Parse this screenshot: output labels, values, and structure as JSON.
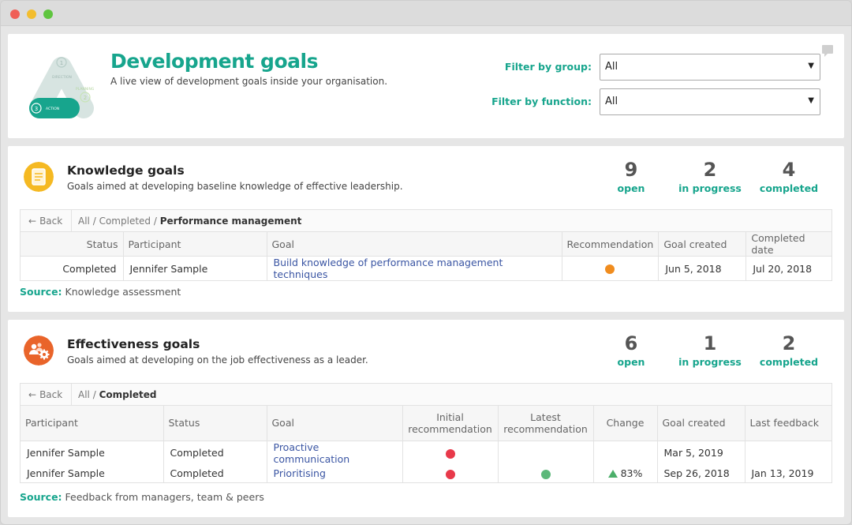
{
  "header": {
    "title": "Development goals",
    "subtitle": "A live view of development goals inside your organisation.",
    "logo_steps": [
      {
        "num": "1",
        "label": "DIRECTION"
      },
      {
        "num": "2",
        "label": "PLANNING"
      },
      {
        "num": "3",
        "label": "ACTION"
      }
    ],
    "filters": [
      {
        "label": "Filter by group:",
        "value": "All"
      },
      {
        "label": "Filter by function:",
        "value": "All"
      }
    ]
  },
  "knowledge": {
    "title": "Knowledge goals",
    "subtitle": "Goals aimed at developing baseline knowledge of effective leadership.",
    "stats": [
      {
        "value": "9",
        "label": "open"
      },
      {
        "value": "2",
        "label": "in progress"
      },
      {
        "value": "4",
        "label": "completed"
      }
    ],
    "back_label": "Back",
    "breadcrumb": [
      "All",
      "Completed",
      "Performance management"
    ],
    "columns": [
      "Status",
      "Participant",
      "Goal",
      "Recommendation",
      "Goal created",
      "Completed date"
    ],
    "rows": [
      {
        "status": "Completed",
        "participant": "Jennifer Sample",
        "goal": "Build knowledge of performance management techniques",
        "recommendation_color": "#f08c1e",
        "created": "Jun 5, 2018",
        "completed": "Jul 20, 2018"
      }
    ],
    "source_label": "Source:",
    "source_value": "Knowledge assessment"
  },
  "effectiveness": {
    "title": "Effectiveness goals",
    "subtitle": "Goals aimed at developing on the job effectiveness as a leader.",
    "stats": [
      {
        "value": "6",
        "label": "open"
      },
      {
        "value": "1",
        "label": "in progress"
      },
      {
        "value": "2",
        "label": "completed"
      }
    ],
    "back_label": "Back",
    "breadcrumb": [
      "All",
      "Completed"
    ],
    "columns": [
      "Participant",
      "Status",
      "Goal",
      "Initial recommendation",
      "Latest recommendation",
      "Change",
      "Goal created",
      "Last feedback"
    ],
    "rows": [
      {
        "participant": "Jennifer Sample",
        "status": "Completed",
        "goal": "Proactive communication",
        "initial_color": "#e8394a",
        "latest_color": "",
        "change": "",
        "created": "Mar 5, 2019",
        "feedback": ""
      },
      {
        "participant": "Jennifer Sample",
        "status": "Completed",
        "goal": "Prioritising",
        "initial_color": "#e8394a",
        "latest_color": "#5cb87a",
        "change": "83%",
        "created": "Sep 26, 2018",
        "feedback": "Jan 13, 2019"
      }
    ],
    "source_label": "Source:",
    "source_value": "Feedback from managers, team & peers"
  },
  "colors": {
    "accent": "#17a58d",
    "link": "#3a55a3",
    "orange": "#f08c1e",
    "red": "#e8394a",
    "green": "#5cb87a"
  }
}
